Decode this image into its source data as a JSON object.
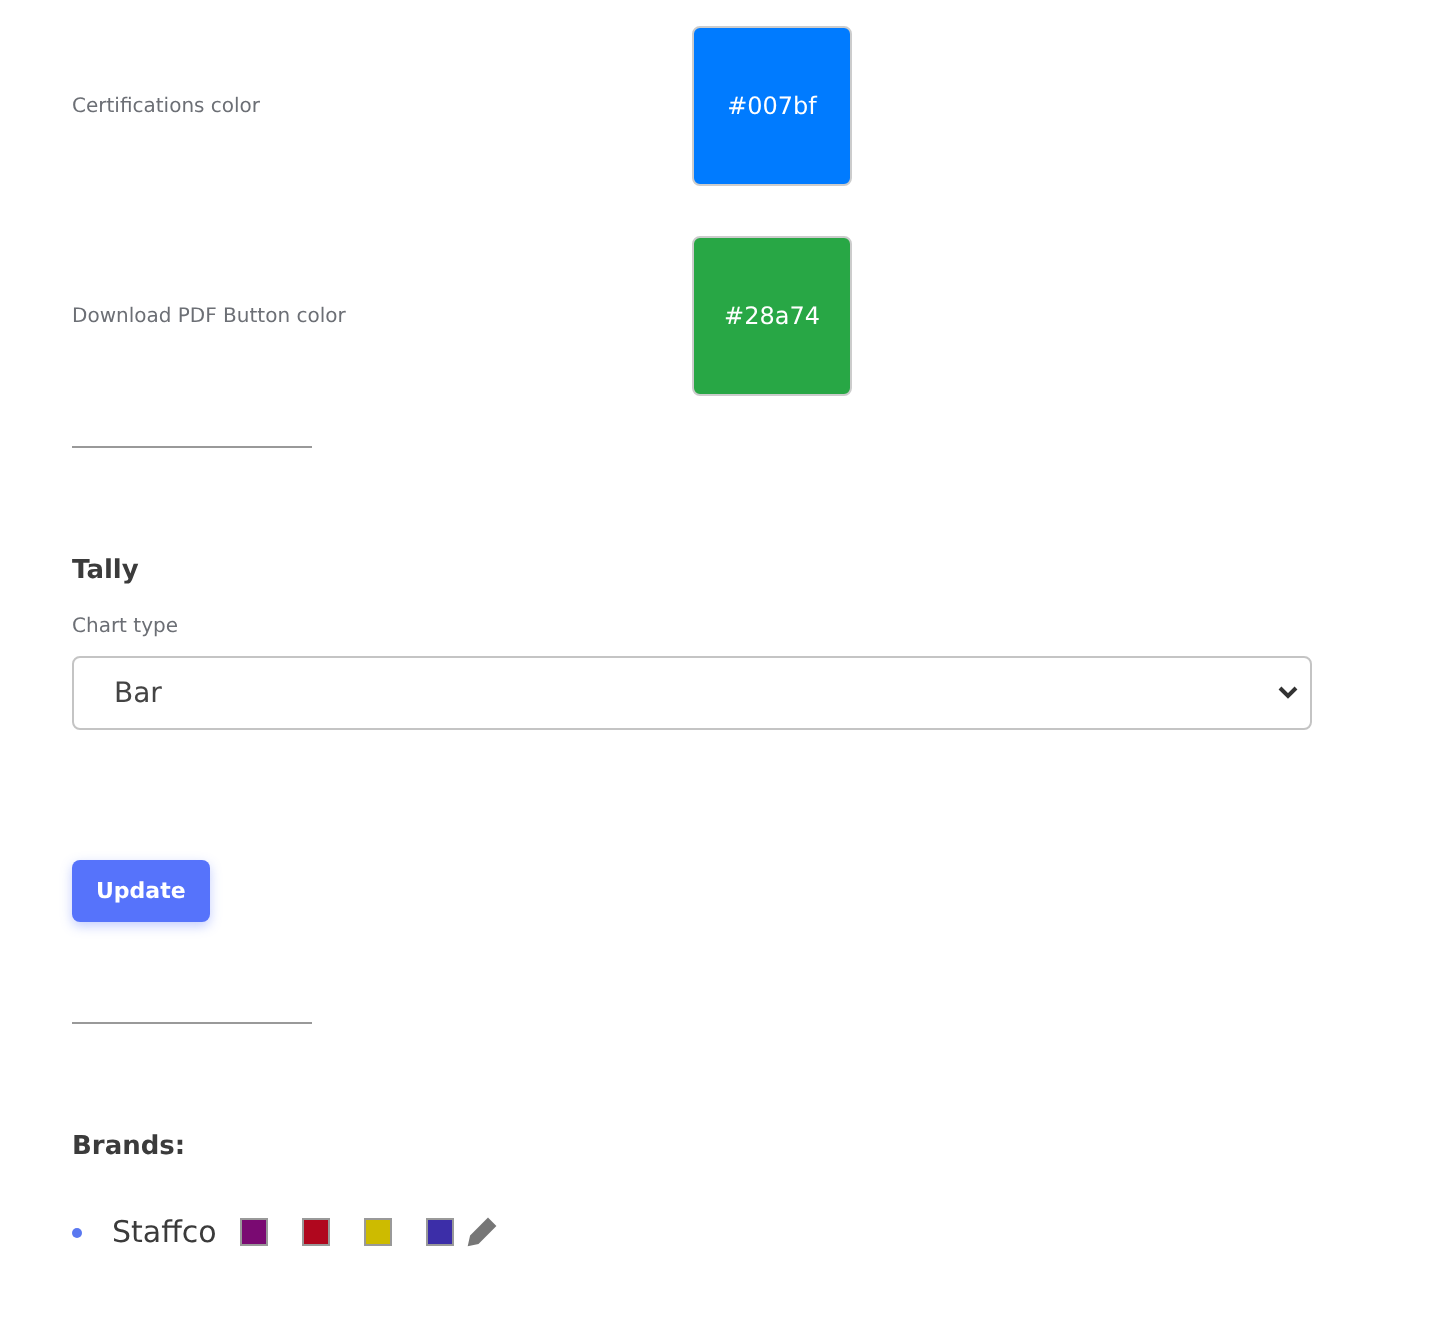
{
  "color_settings": [
    {
      "label": "Certifications color",
      "value": "#007bf",
      "color": "#007bff"
    },
    {
      "label": "Download PDF Button color",
      "value": "#28a74",
      "color": "#28a745"
    }
  ],
  "tally": {
    "heading": "Tally",
    "chart_type_label": "Chart type",
    "chart_type": "Bar",
    "button": "Update"
  },
  "brands": {
    "heading": "Brands:",
    "items": [
      {
        "name": "Staffco",
        "colors": [
          {
            "color": "#7a0a72"
          },
          {
            "color": "#b0071e"
          },
          {
            "color": "#cdbb00"
          },
          {
            "color": "#3c2ea8"
          }
        ]
      }
    ]
  }
}
